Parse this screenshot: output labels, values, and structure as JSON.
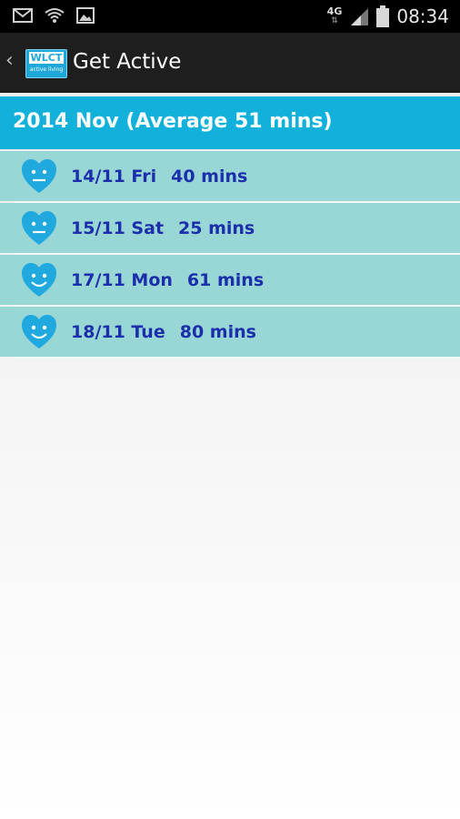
{
  "status_bar": {
    "icons": [
      "mail-icon",
      "wifi-icon",
      "image-icon"
    ],
    "network_type": "4G",
    "time": "08:34"
  },
  "action_bar": {
    "logo_text": "WLCT",
    "logo_subtext": "active living",
    "title": "Get Active"
  },
  "summary": {
    "header": "2014 Nov (Average 51 mins)"
  },
  "entries": [
    {
      "date": "14/11 Fri",
      "duration": "40 mins",
      "icon": "neutral-heart-face-icon"
    },
    {
      "date": "15/11 Sat",
      "duration": "25 mins",
      "icon": "neutral-heart-face-icon"
    },
    {
      "date": "17/11 Mon",
      "duration": "61 mins",
      "icon": "smiling-heart-face-icon"
    },
    {
      "date": "18/11 Tue",
      "duration": "80 mins",
      "icon": "smiling-heart-face-icon"
    }
  ],
  "colors": {
    "header_bg": "#12b1dc",
    "row_bg": "#99d6d6",
    "row_text": "#1b2faa",
    "heart": "#1fa9de"
  }
}
